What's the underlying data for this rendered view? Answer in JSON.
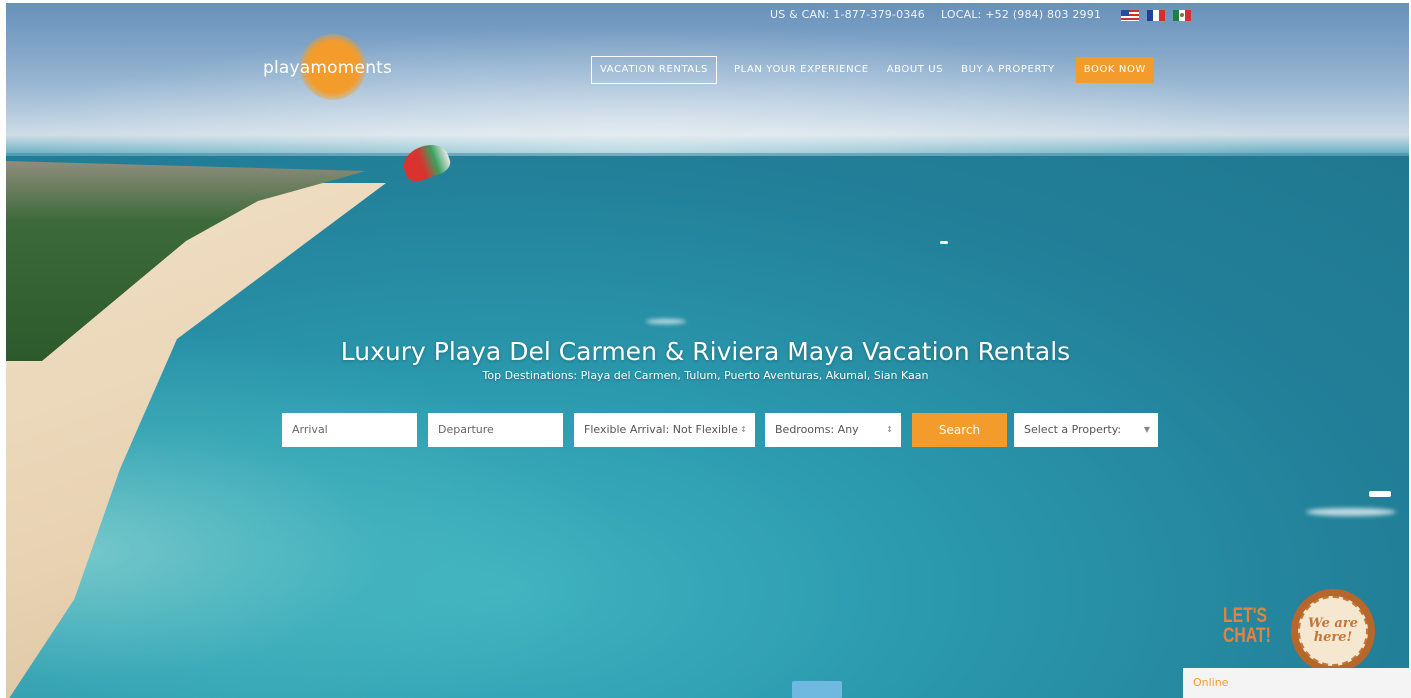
{
  "topbar": {
    "us_can": "US & CAN: 1-877-379-0346",
    "local": "LOCAL: +52 (984) 803 2991"
  },
  "logo": {
    "text": "playamoments"
  },
  "nav": {
    "items": [
      "VACATION RENTALS",
      "PLAN YOUR EXPERIENCE",
      "ABOUT US",
      "BUY A PROPERTY"
    ],
    "book": "BOOK NOW"
  },
  "hero": {
    "title": "Luxury Playa Del Carmen & Riviera Maya Vacation Rentals",
    "subtitle": "Top Destinations: Playa del Carmen, Tulum, Puerto Aventuras, Akumal, Sian Kaan"
  },
  "search": {
    "arrival_placeholder": "Arrival",
    "departure_placeholder": "Departure",
    "flexible": "Flexible Arrival: Not Flexible",
    "bedrooms": "Bedrooms: Any",
    "button": "Search",
    "property": "Select a Property:"
  },
  "chat": {
    "lets": "LET'S",
    "chat": "CHAT!",
    "badge_line1": "We are",
    "badge_line2": "here!",
    "status": "Online"
  },
  "colors": {
    "accent": "#f39c2b",
    "sea": "#2a8ea5"
  }
}
